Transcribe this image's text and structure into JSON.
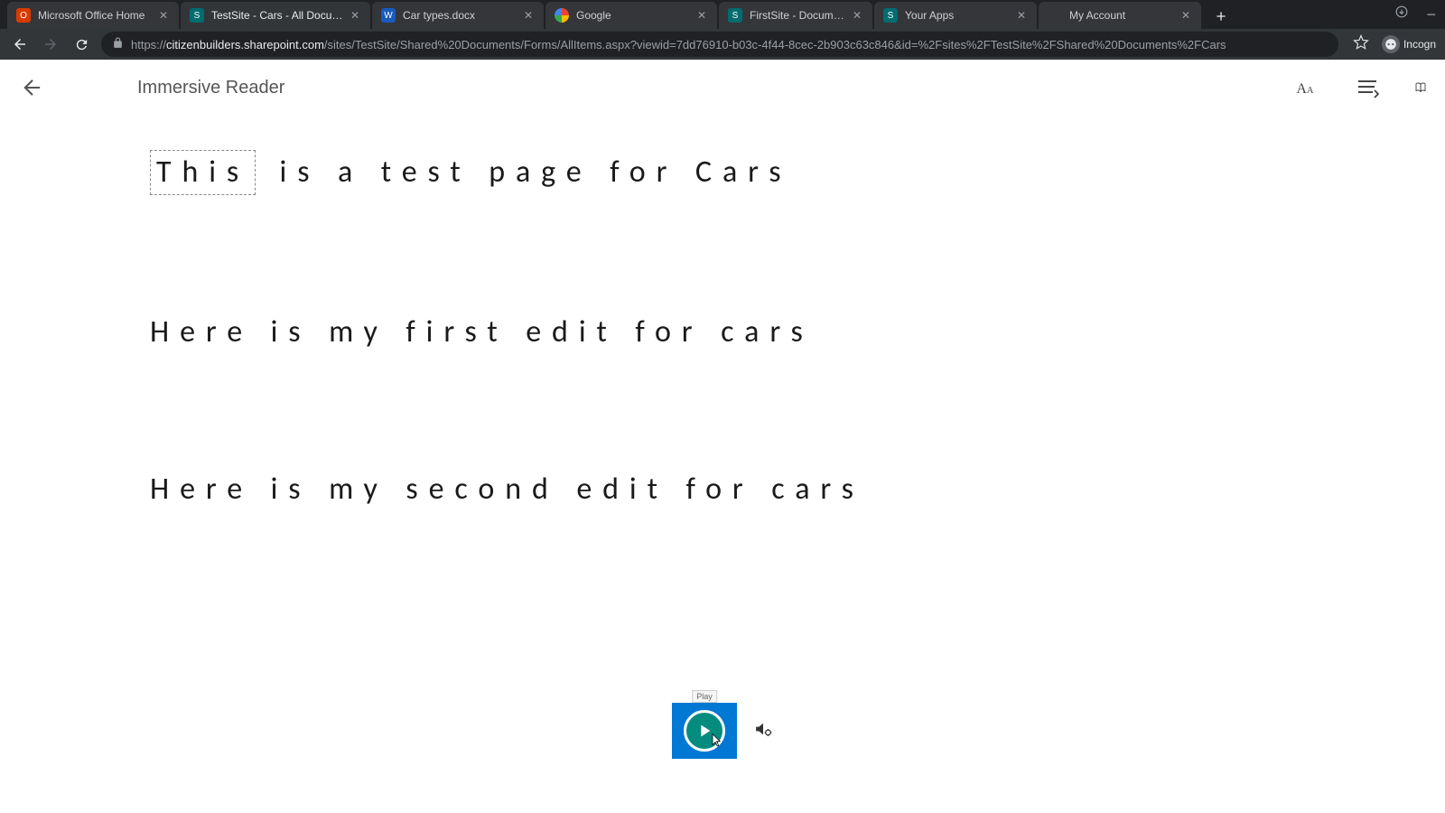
{
  "browser": {
    "tabs": [
      {
        "title": "Microsoft Office Home",
        "favicon": "office",
        "active": false
      },
      {
        "title": "TestSite - Cars - All Documents",
        "favicon": "sharepoint",
        "active": true
      },
      {
        "title": "Car types.docx",
        "favicon": "word",
        "active": false
      },
      {
        "title": "Google",
        "favicon": "google",
        "active": false
      },
      {
        "title": "FirstSite - Documents - All Docu...",
        "favicon": "sharepoint",
        "active": false
      },
      {
        "title": "Your Apps",
        "favicon": "sharepoint",
        "active": false
      },
      {
        "title": "My Account",
        "favicon": "microsoft",
        "active": false
      }
    ],
    "url_scheme": "https://",
    "url_host": "citizenbuilders.sharepoint.com",
    "url_path": "/sites/TestSite/Shared%20Documents/Forms/AllItems.aspx?viewid=7dd76910-b03c-4f44-8cec-2b903c63c846&id=%2Fsites%2FTestSite%2FShared%20Documents%2FCars",
    "profile_label": "Incogn"
  },
  "reader": {
    "title": "Immersive Reader",
    "paragraphs": {
      "p1_first": "This",
      "p1_rest": " is a test page for Cars",
      "p2": "Here is my first edit for cars",
      "p3": "Here is my second edit for cars"
    },
    "play_tooltip": "Play"
  }
}
